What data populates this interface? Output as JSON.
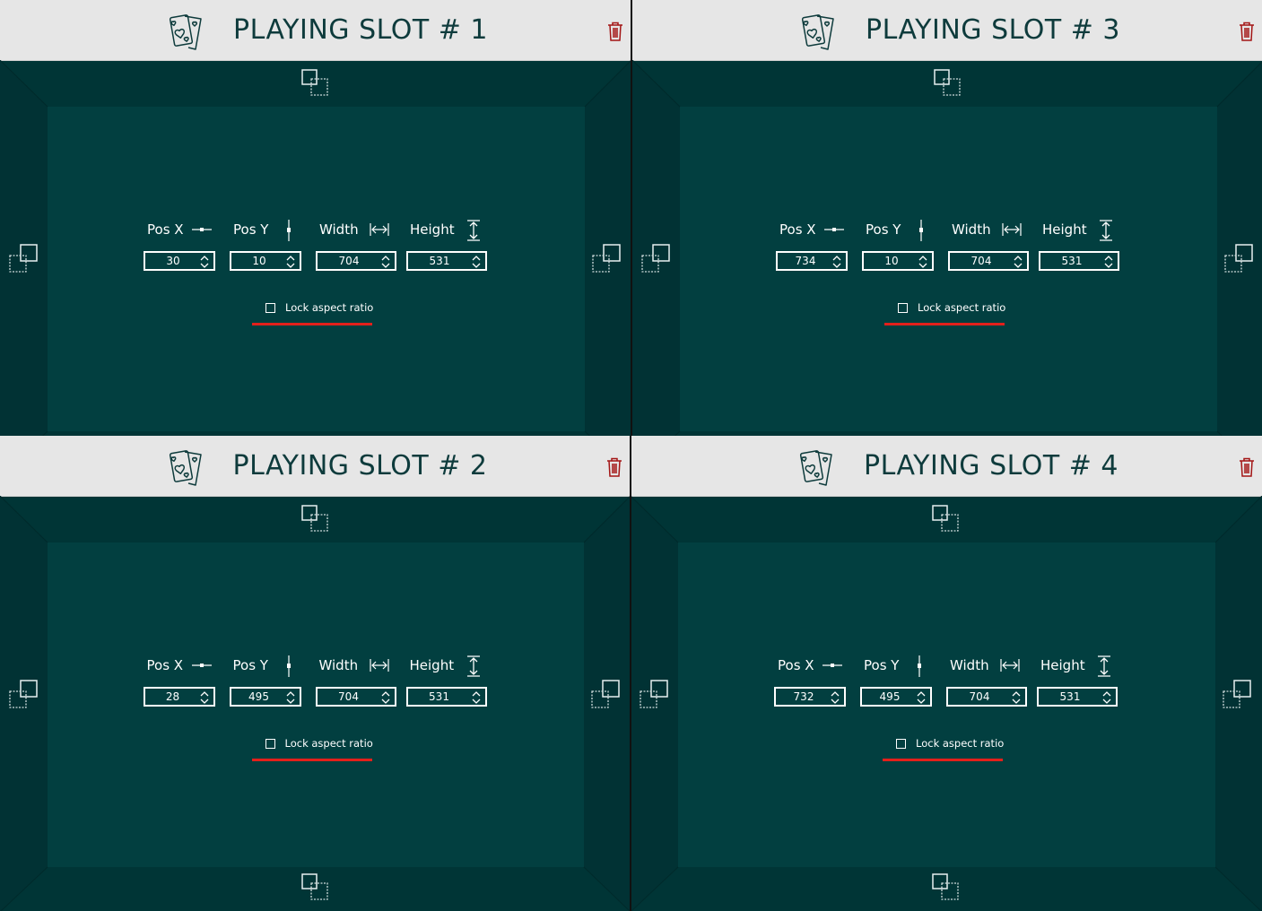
{
  "colors": {
    "header_bg": "#e6e6e6",
    "title_text": "#0e3b3c",
    "frame_bg": "#003536",
    "inner_bg": "#023f40",
    "trash": "#a31515",
    "annotation_underline": "#e3201b"
  },
  "labels": {
    "pos_x": "Pos X",
    "pos_y": "Pos Y",
    "width": "Width",
    "height": "Height",
    "lock_aspect_ratio": "Lock aspect ratio"
  },
  "icons": {
    "header": "playing-cards-icon",
    "delete": "trash-icon",
    "pos_x": "horizontal-slider-icon",
    "pos_y": "vertical-slider-icon",
    "width": "width-arrows-icon",
    "height": "height-arrows-icon",
    "resize_handle": "resize-handle-icon",
    "spinner": "up-down-chevron-icon"
  },
  "slots": [
    {
      "title": "PLAYING SLOT # 1",
      "pos_x": "30",
      "pos_y": "10",
      "width": "704",
      "height": "531",
      "lock_aspect_ratio": false
    },
    {
      "title": "PLAYING SLOT # 2",
      "pos_x": "28",
      "pos_y": "495",
      "width": "704",
      "height": "531",
      "lock_aspect_ratio": false
    },
    {
      "title": "PLAYING SLOT # 3",
      "pos_x": "734",
      "pos_y": "10",
      "width": "704",
      "height": "531",
      "lock_aspect_ratio": false
    },
    {
      "title": "PLAYING SLOT # 4",
      "pos_x": "732",
      "pos_y": "495",
      "width": "704",
      "height": "531",
      "lock_aspect_ratio": false
    }
  ]
}
